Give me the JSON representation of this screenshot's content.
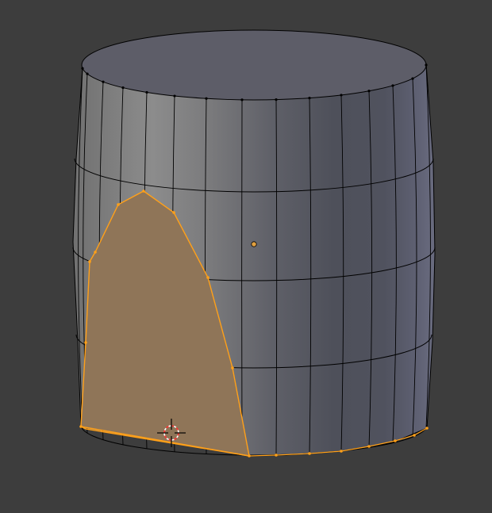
{
  "viewport": {
    "background": "#3d3d3d",
    "mesh": "barrel-cylinder",
    "edit_mode": "face-select",
    "colors": {
      "face_light": "#8a8a8a",
      "face_dark": "#4a4c58",
      "top_face": "#5d5d68",
      "wire": "#000000",
      "selected_face": "#8f7558",
      "selected_edge": "#ffa019",
      "object_origin": "#e0a040",
      "cursor": "#000000",
      "cursor_ring_red": "#ff3030"
    },
    "icons": {
      "cursor": "3d-cursor-icon",
      "origin": "object-origin-icon"
    }
  }
}
